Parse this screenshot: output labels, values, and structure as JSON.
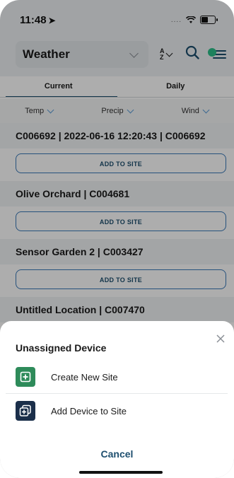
{
  "status": {
    "time": "11:48",
    "location_arrow": "➤",
    "signal_dots": "....",
    "battery_icon": "battery-icon"
  },
  "header": {
    "selector_label": "Weather",
    "sort_label": "A\nZ"
  },
  "tabs": [
    {
      "label": "Current",
      "active": true
    },
    {
      "label": "Daily",
      "active": false
    }
  ],
  "subtabs": [
    "Temp",
    "Precip",
    "Wind"
  ],
  "locations": [
    {
      "name": "C006692 | 2022-06-16 12:20:43 | C006692",
      "button": "ADD TO SITE"
    },
    {
      "name": "Olive Orchard | C004681",
      "button": "ADD TO SITE"
    },
    {
      "name": "Sensor Garden 2 | C003427",
      "button": "ADD TO SITE"
    },
    {
      "name": "Untitled Location | C007470",
      "button": ""
    }
  ],
  "sheet": {
    "title": "Unassigned Device",
    "actions": [
      {
        "label": "Create New Site",
        "icon": "plus-square-icon",
        "color": "#2e8b5a"
      },
      {
        "label": "Add Device to Site",
        "icon": "layers-plus-icon",
        "color": "#1b2f4a"
      }
    ],
    "cancel": "Cancel"
  },
  "colors": {
    "accent": "#1d4e6e",
    "button_border": "#3a79b8",
    "green": "#2e8b5a",
    "navy": "#1b2f4a",
    "toggle_green": "#2bbf8a"
  }
}
